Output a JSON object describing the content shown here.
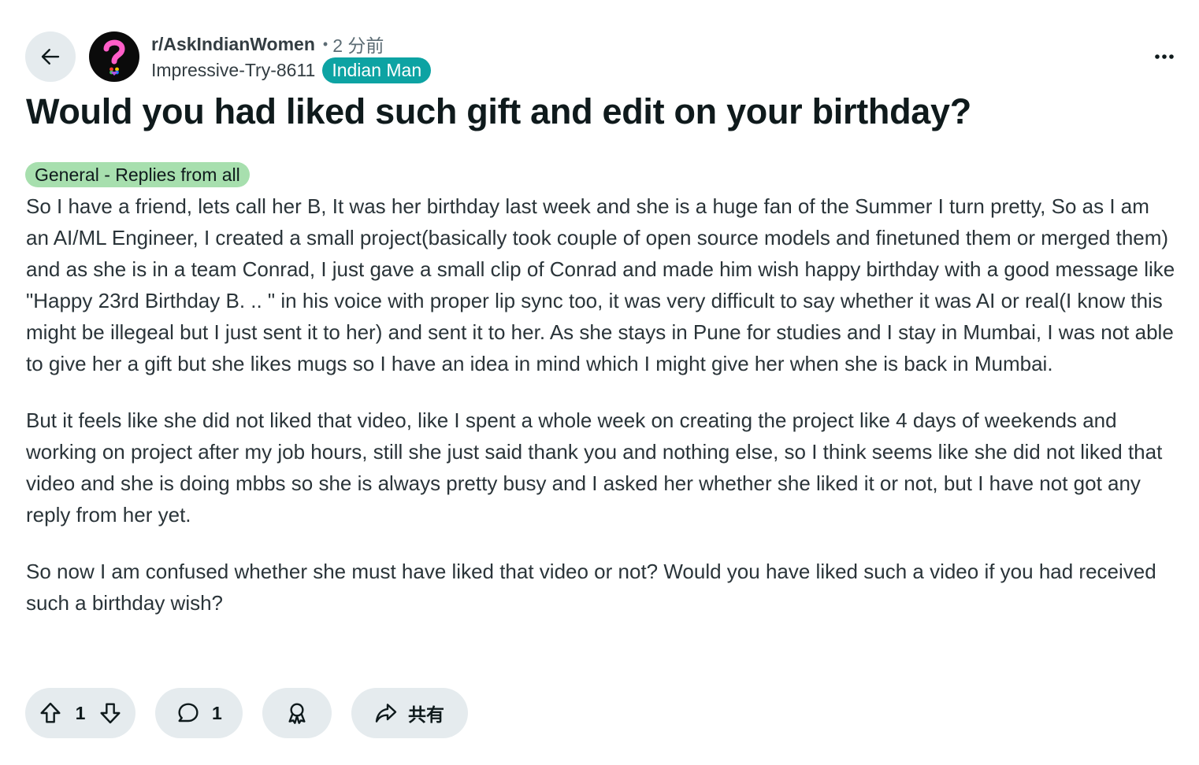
{
  "header": {
    "subreddit": "r/AskIndianWomen",
    "separator": "•",
    "time_ago": "2 分前",
    "author": "Impressive-Try-8611",
    "user_flair": "Indian Man"
  },
  "post": {
    "title": "Would you had liked such gift and edit on your birthday?",
    "flair": "General - Replies from all",
    "paragraphs": [
      "So I have a friend, lets call her B, It was her birthday last week and she is a huge fan of the Summer I turn pretty, So as I am an AI/ML Engineer, I created a small project(basically took couple of open source models and finetuned them or merged them) and as she is in a team Conrad, I just gave a small clip of Conrad and made him wish happy birthday with a good message like \"Happy 23rd Birthday B. .. \" in his voice with proper lip sync too, it was very difficult to say whether it was AI or real(I know this might be illegeal but I just sent it to her) and sent it to her. As she stays in Pune for studies and I stay in Mumbai, I was not able to give her a gift but she likes mugs so I have an idea in mind which I might give her when she is back in Mumbai.",
      "But it feels like she did not liked that video, like I spent a whole week on creating the project like 4 days of weekends and working on project after my job hours, still she just said thank you and nothing else, so I think seems like she did not liked that video and she is doing mbbs so she is always pretty busy and I asked her whether she liked it or not, but I have not got any reply from her yet.",
      "So now I am confused whether she must have liked that video or not? Would you have liked such a video if you had received such a birthday wish?"
    ]
  },
  "actions": {
    "vote_count": "1",
    "comment_count": "1",
    "share_label": "共有"
  },
  "icons": {
    "back": "arrow-left-icon",
    "avatar": "question-mark-avatar",
    "more": "more-horizontal-icon",
    "upvote": "upvote-arrow-icon",
    "downvote": "downvote-arrow-icon",
    "comment": "speech-bubble-icon",
    "award": "award-ribbon-icon",
    "share": "share-arrow-icon"
  },
  "colors": {
    "user_flair_bg": "#0da3a3",
    "post_flair_bg": "#a7dfae",
    "button_bg": "#e5ebee",
    "avatar_question": "#ff5ec8"
  }
}
